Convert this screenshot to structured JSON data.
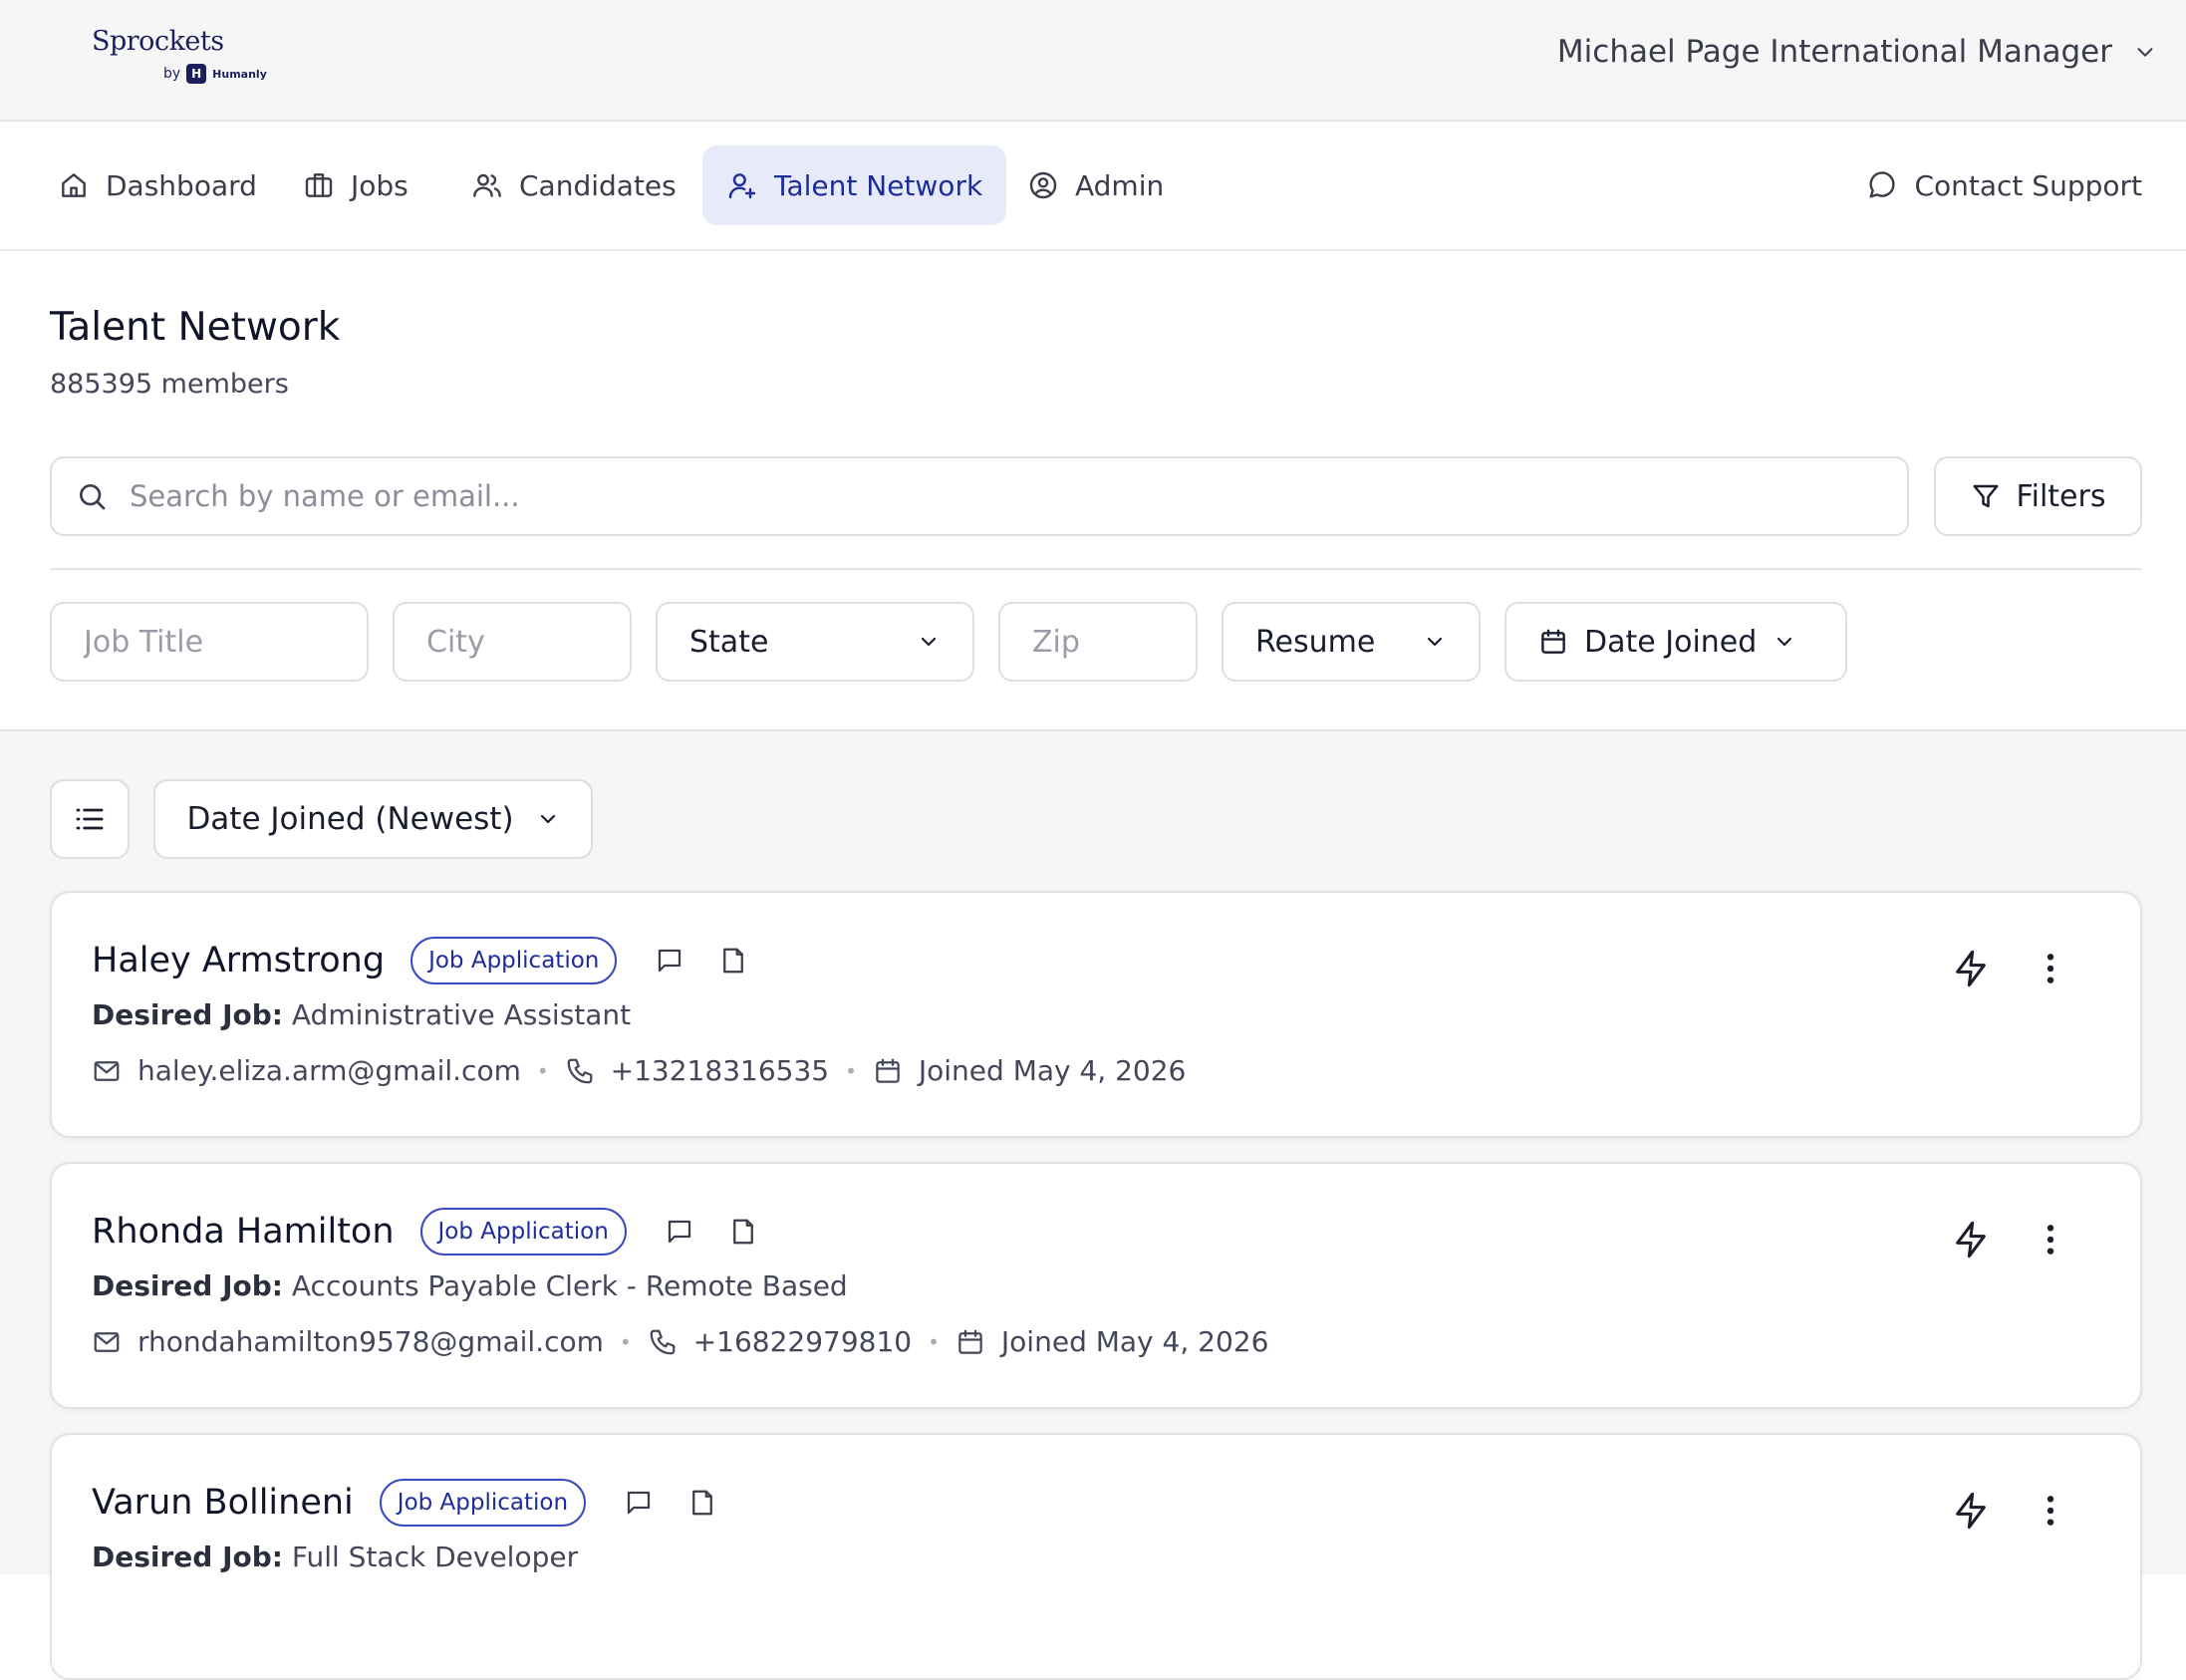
{
  "brand": {
    "name": "Sprockets",
    "by": "by",
    "company": "Humanly"
  },
  "account": {
    "label": "Michael Page International Manager"
  },
  "nav": {
    "items": [
      {
        "label": "Dashboard",
        "icon": "home-icon"
      },
      {
        "label": "Jobs",
        "icon": "briefcase-icon"
      },
      {
        "label": "Candidates",
        "icon": "users-icon"
      },
      {
        "label": "Talent Network",
        "icon": "user-plus-icon",
        "active": true
      },
      {
        "label": "Admin",
        "icon": "user-circle-icon"
      }
    ],
    "support": {
      "label": "Contact Support",
      "icon": "message-circle-icon"
    }
  },
  "page": {
    "title": "Talent Network",
    "member_count": "885395 members"
  },
  "search": {
    "placeholder": "Search by name or email...",
    "value": ""
  },
  "filters_button": {
    "label": "Filters"
  },
  "filter_fields": {
    "job_title": {
      "placeholder": "Job Title",
      "value": ""
    },
    "city": {
      "placeholder": "City",
      "value": ""
    },
    "state": {
      "label": "State"
    },
    "zip": {
      "placeholder": "Zip",
      "value": ""
    },
    "resume": {
      "label": "Resume"
    },
    "date_joined": {
      "label": "Date Joined"
    }
  },
  "sort": {
    "label": "Date Joined (Newest)"
  },
  "candidates": [
    {
      "name": "Haley Armstrong",
      "badge": "Job Application",
      "desired_label": "Desired Job:",
      "desired_job": "Administrative Assistant",
      "email": "haley.eliza.arm@gmail.com",
      "phone": "+13218316535",
      "joined": "Joined May 4, 2026"
    },
    {
      "name": "Rhonda Hamilton",
      "badge": "Job Application",
      "desired_label": "Desired Job:",
      "desired_job": "Accounts Payable Clerk - Remote Based",
      "email": "rhondahamilton9578@gmail.com",
      "phone": "+16822979810",
      "joined": "Joined May 4, 2026"
    },
    {
      "name": "Varun Bollineni",
      "badge": "Job Application",
      "desired_label": "Desired Job:",
      "desired_job": "Full Stack Developer",
      "email": "",
      "phone": "",
      "joined": ""
    }
  ],
  "colors": {
    "accent": "#1f2d9b",
    "active_nav_bg": "#e7eaf8",
    "list_bg": "#f6f6f7",
    "text": "#1a1d2e"
  }
}
